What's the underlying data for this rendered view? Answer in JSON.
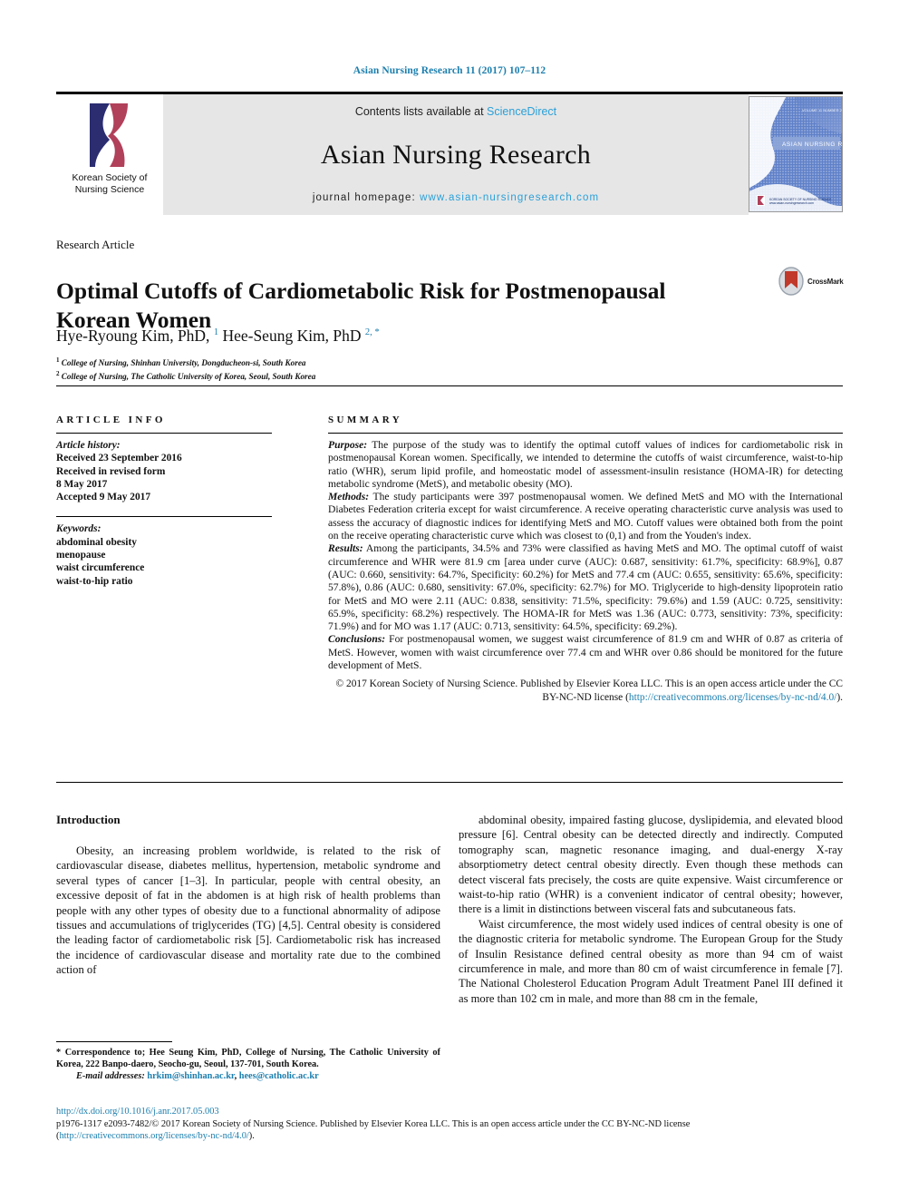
{
  "running_head": "Asian Nursing Research 11 (2017) 107–112",
  "masthead": {
    "society_logo_text_line1": "Korean Society of",
    "society_logo_text_line2": "Nursing Science",
    "contents_prefix": "Contents lists available at ",
    "contents_link": "ScienceDirect",
    "journal_title": "Asian Nursing Research",
    "homepage_prefix": "journal homepage: ",
    "homepage_url": "www.asian-nursingresearch.com",
    "cover_caption": "ASIAN NURSING RESEARCH"
  },
  "article": {
    "type": "Research Article",
    "title": "Optimal Cutoffs of Cardiometabolic Risk for Postmenopausal Korean Women",
    "crossmark_label": "CrossMark",
    "authors_html": "Hye-Ryoung Kim, PhD, <sup>1</sup> Hee-Seung Kim, PhD <sup>2, *</sup>",
    "affiliation_1": "College of Nursing, Shinhan University, Dongducheon-si, South Korea",
    "affiliation_2": "College of Nursing, The Catholic University of Korea, Seoul, South Korea"
  },
  "article_info": {
    "heading": "ARTICLE INFO",
    "history_label": "Article history:",
    "history_lines": [
      "Received 23 September 2016",
      "Received in revised form",
      "8 May 2017",
      "Accepted 9 May 2017"
    ],
    "keywords_label": "Keywords:",
    "keywords": [
      "abdominal obesity",
      "menopause",
      "waist circumference",
      "waist-to-hip ratio"
    ]
  },
  "summary": {
    "heading": "SUMMARY",
    "purpose_label": "Purpose:",
    "purpose_text": " The purpose of the study was to identify the optimal cutoff values of indices for cardiometabolic risk in postmenopausal Korean women. Specifically, we intended to determine the cutoffs of waist circumference, waist-to-hip ratio (WHR), serum lipid profile, and homeostatic model of assessment-insulin resistance (HOMA-IR) for detecting metabolic syndrome (MetS), and metabolic obesity (MO).",
    "methods_label": "Methods:",
    "methods_text": " The study participants were 397 postmenopausal women. We defined MetS and MO with the International Diabetes Federation criteria except for waist circumference. A receive operating characteristic curve analysis was used to assess the accuracy of diagnostic indices for identifying MetS and MO. Cutoff values were obtained both from the point on the receive operating characteristic curve which was closest to (0,1) and from the Youden's index.",
    "results_label": "Results:",
    "results_text": " Among the participants, 34.5% and 73% were classified as having MetS and MO. The optimal cutoff of waist circumference and WHR were 81.9 cm [area under curve (AUC): 0.687, sensitivity: 61.7%, specificity: 68.9%], 0.87 (AUC: 0.660, sensitivity: 64.7%, Specificity: 60.2%) for MetS and 77.4 cm (AUC: 0.655, sensitivity: 65.6%, specificity: 57.8%), 0.86 (AUC: 0.680, sensitivity: 67.0%, specificity: 62.7%) for MO. Triglyceride to high-density lipoprotein ratio for MetS and MO were 2.11 (AUC: 0.838, sensitivity: 71.5%, specificity: 79.6%) and 1.59 (AUC: 0.725, sensitivity: 65.9%, specificity: 68.2%) respectively. The HOMA-IR for MetS was 1.36 (AUC: 0.773, sensitivity: 73%, specificity: 71.9%) and for MO was 1.17 (AUC: 0.713, sensitivity: 64.5%, specificity: 69.2%).",
    "conclusions_label": "Conclusions:",
    "conclusions_text": " For postmenopausal women, we suggest waist circumference of 81.9 cm and WHR of 0.87 as criteria of MetS. However, women with waist circumference over 77.4 cm and WHR over 0.86 should be monitored for the future development of MetS.",
    "copyright_text": "© 2017 Korean Society of Nursing Science. Published by Elsevier Korea LLC. This is an open access article under the CC BY-NC-ND license (",
    "copyright_link": "http://creativecommons.org/licenses/by-nc-nd/4.0/",
    "copyright_tail": ")."
  },
  "body": {
    "intro_heading": "Introduction",
    "left_paragraph": "Obesity, an increasing problem worldwide, is related to the risk of cardiovascular disease, diabetes mellitus, hypertension, metabolic syndrome and several types of cancer [1–3]. In particular, people with central obesity, an excessive deposit of fat in the abdomen is at high risk of health problems than people with any other types of obesity due to a functional abnormality of adipose tissues and accumulations of triglycerides (TG) [4,5]. Central obesity is considered the leading factor of cardiometabolic risk [5]. Cardiometabolic risk has increased the incidence of cardiovascular disease and mortality rate due to the combined action of",
    "right_paragraph_1": "abdominal obesity, impaired fasting glucose, dyslipidemia, and elevated blood pressure [6]. Central obesity can be detected directly and indirectly. Computed tomography scan, magnetic resonance imaging, and dual-energy X-ray absorptiometry detect central obesity directly. Even though these methods can detect visceral fats precisely, the costs are quite expensive. Waist circumference or waist-to-hip ratio (WHR) is a convenient indicator of central obesity; however, there is a limit in distinctions between visceral fats and subcutaneous fats.",
    "right_paragraph_2": "Waist circumference, the most widely used indices of central obesity is one of the diagnostic criteria for metabolic syndrome. The European Group for the Study of Insulin Resistance defined central obesity as more than 94 cm of waist circumference in male, and more than 80 cm of waist circumference in female [7]. The National Cholesterol Education Program Adult Treatment Panel III defined it as more than 102 cm in male, and more than 88 cm in the female,"
  },
  "footnote": {
    "correspondence": "* Correspondence to; Hee Seung Kim, PhD, College of Nursing, The Catholic University of Korea, 222 Banpo-daero, Seocho-gu, Seoul, 137-701, South Korea.",
    "email_label": "E-mail addresses:",
    "email_1": "hrkim@shinhan.ac.kr",
    "email_2": "hees@catholic.ac.kr"
  },
  "bottom": {
    "doi": "http://dx.doi.org/10.1016/j.anr.2017.05.003",
    "issn_text": "p1976-1317 e2093-7482/© 2017 Korean Society of Nursing Science. Published by Elsevier Korea LLC. This is an open access article under the CC BY-NC-ND license (",
    "issn_link": "http://creativecommons.org/licenses/by-nc-nd/4.0/",
    "issn_tail": ")."
  },
  "colors": {
    "link": "#1b7eae",
    "sciencedirect": "#2aa0d8",
    "banner_bg": "#e6e6e6",
    "logo_navy": "#2b2d70",
    "logo_crimson": "#b1405a",
    "crossmark_red": "#c0392b",
    "cover_blue": "#4a6fc0"
  }
}
